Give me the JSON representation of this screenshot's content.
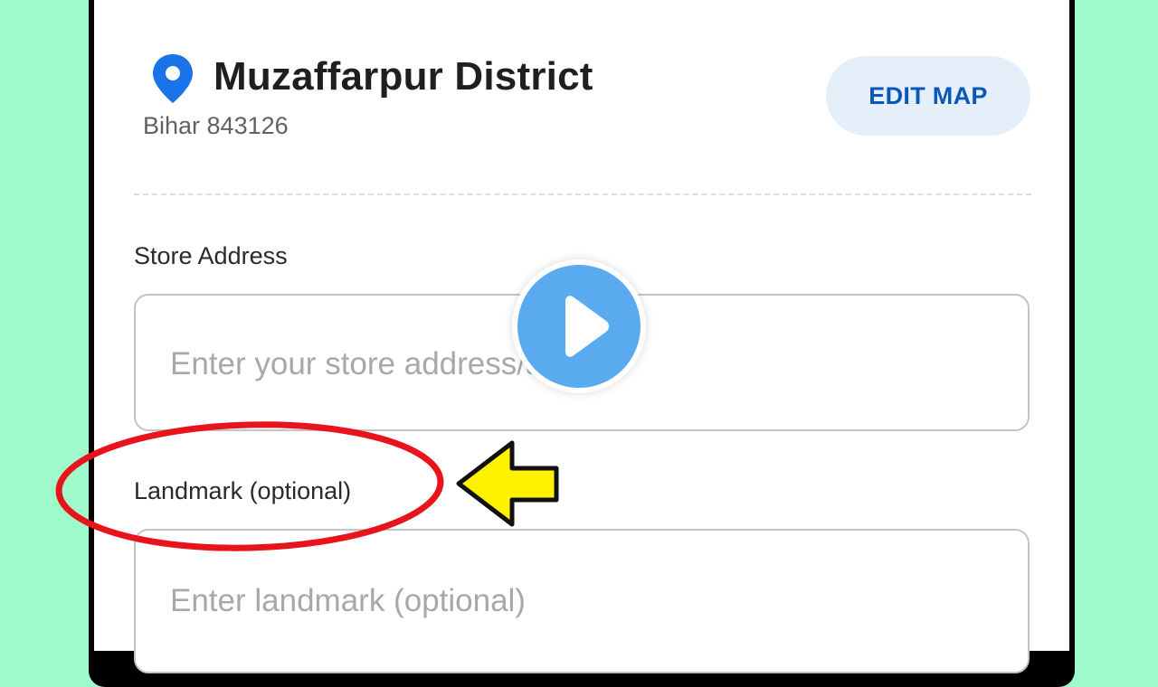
{
  "location": {
    "title": "Muzaffarpur District",
    "subtitle": "Bihar 843126",
    "pin_icon": "location-pin-icon",
    "pin_color": "#1a73e8"
  },
  "edit_map": {
    "label": "EDIT MAP",
    "background": "#e4effa",
    "text_color": "#0b57b7"
  },
  "form": {
    "store_address": {
      "label": "Store Address",
      "placeholder": "Enter your store address/area",
      "value": ""
    },
    "landmark": {
      "label": "Landmark (optional)",
      "placeholder": "Enter landmark (optional)",
      "value": ""
    }
  },
  "overlay": {
    "play_icon": "play-icon",
    "highlight_color": "#e8141b",
    "arrow_color": "#fff200",
    "arrow_icon": "arrow-left-icon",
    "background_color": "#9ffbcc"
  }
}
